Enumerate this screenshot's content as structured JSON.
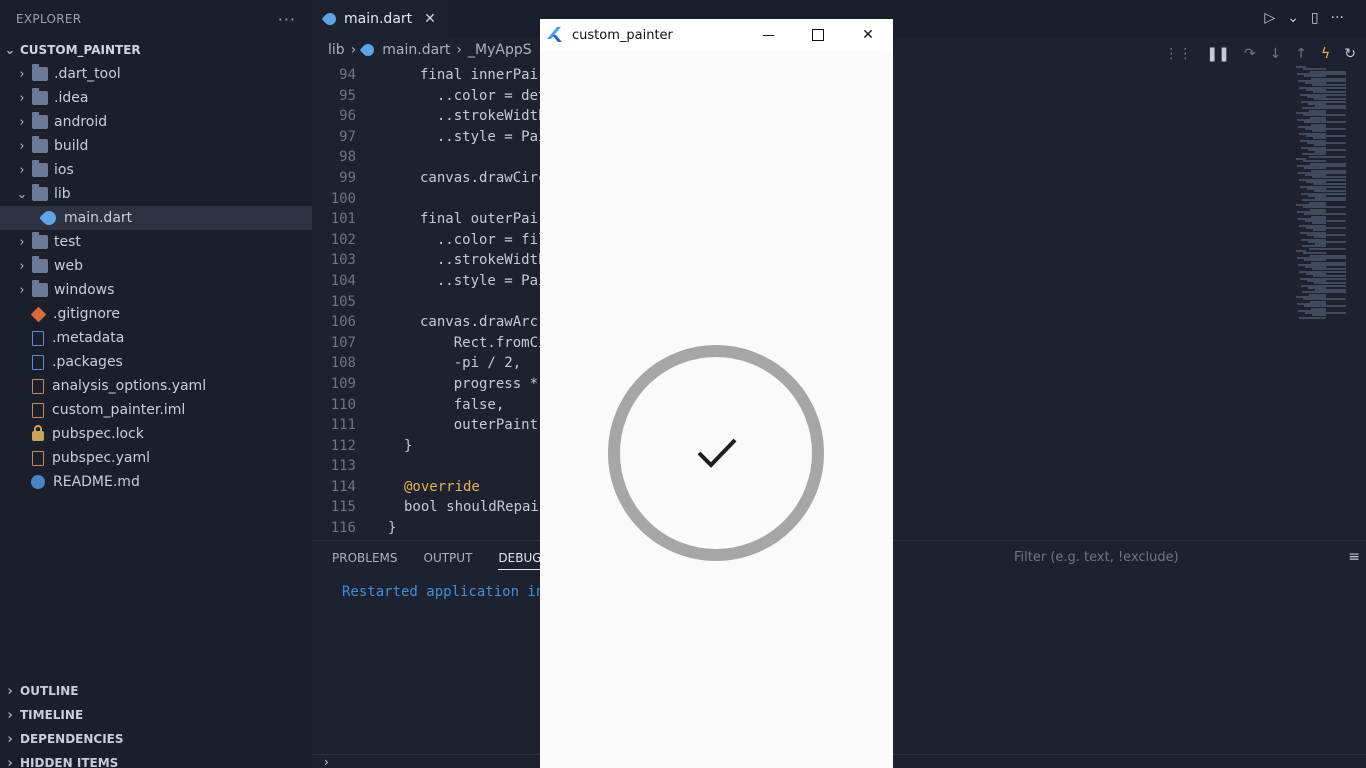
{
  "sidebar": {
    "title": "EXPLORER",
    "more": "···",
    "project": "CUSTOM_PAINTER",
    "items": [
      {
        "label": ".dart_tool"
      },
      {
        "label": ".idea"
      },
      {
        "label": "android"
      },
      {
        "label": "build"
      },
      {
        "label": "ios"
      },
      {
        "label": "lib"
      },
      {
        "label": "main.dart"
      },
      {
        "label": "test"
      },
      {
        "label": "web"
      },
      {
        "label": "windows"
      },
      {
        "label": ".gitignore"
      },
      {
        "label": ".metadata"
      },
      {
        "label": ".packages"
      },
      {
        "label": "analysis_options.yaml"
      },
      {
        "label": "custom_painter.iml"
      },
      {
        "label": "pubspec.lock"
      },
      {
        "label": "pubspec.yaml"
      },
      {
        "label": "README.md"
      }
    ],
    "sections": [
      "OUTLINE",
      "TIMELINE",
      "DEPENDENCIES",
      "HIDDEN ITEMS"
    ]
  },
  "editor": {
    "tab": "main.dart",
    "breadcrumb": [
      "lib",
      "main.dart",
      "_MyAppS"
    ],
    "lines": [
      {
        "n": "94",
        "code": "final innerPai"
      },
      {
        "n": "95",
        "code": "  ..color = det"
      },
      {
        "n": "96",
        "code": "  ..strokeWidth"
      },
      {
        "n": "97",
        "code": "  ..style = Pai"
      },
      {
        "n": "98",
        "code": ""
      },
      {
        "n": "99",
        "code": "canvas.drawCirc                        int);"
      },
      {
        "n": "100",
        "code": ""
      },
      {
        "n": "101",
        "code": "final outerPai"
      },
      {
        "n": "102",
        "code": "  ..color = fil"
      },
      {
        "n": "103",
        "code": "  ..strokeWidth"
      },
      {
        "n": "104",
        "code": "  ..style = Pai"
      },
      {
        "n": "105",
        "code": ""
      },
      {
        "n": "106",
        "code": "canvas.drawArc("
      },
      {
        "n": "107",
        "code": "    Rect.fromCi                         s: radius),"
      },
      {
        "n": "108",
        "code": "    -pi / 2,"
      },
      {
        "n": "109",
        "code": "    progress *"
      },
      {
        "n": "110",
        "code": "    false,"
      },
      {
        "n": "111",
        "code": "    outerPaint)"
      },
      {
        "n": "112",
        "code": "}"
      },
      {
        "n": "113",
        "code": ""
      },
      {
        "n": "114",
        "code": "@override"
      },
      {
        "n": "115",
        "code": "bool shouldRepai                       true;"
      },
      {
        "n": "116",
        "code": "}"
      }
    ]
  },
  "panel": {
    "tabs": [
      "PROBLEMS",
      "OUTPUT",
      "DEBUG CO"
    ],
    "filter_placeholder": "Filter (e.g. text, !exclude)",
    "console": "Restarted application in"
  },
  "app": {
    "title": "custom_painter",
    "minimize": "",
    "maximize": "",
    "close": "✕",
    "progress": 1.0,
    "ring_color": "#a6a6a6"
  }
}
